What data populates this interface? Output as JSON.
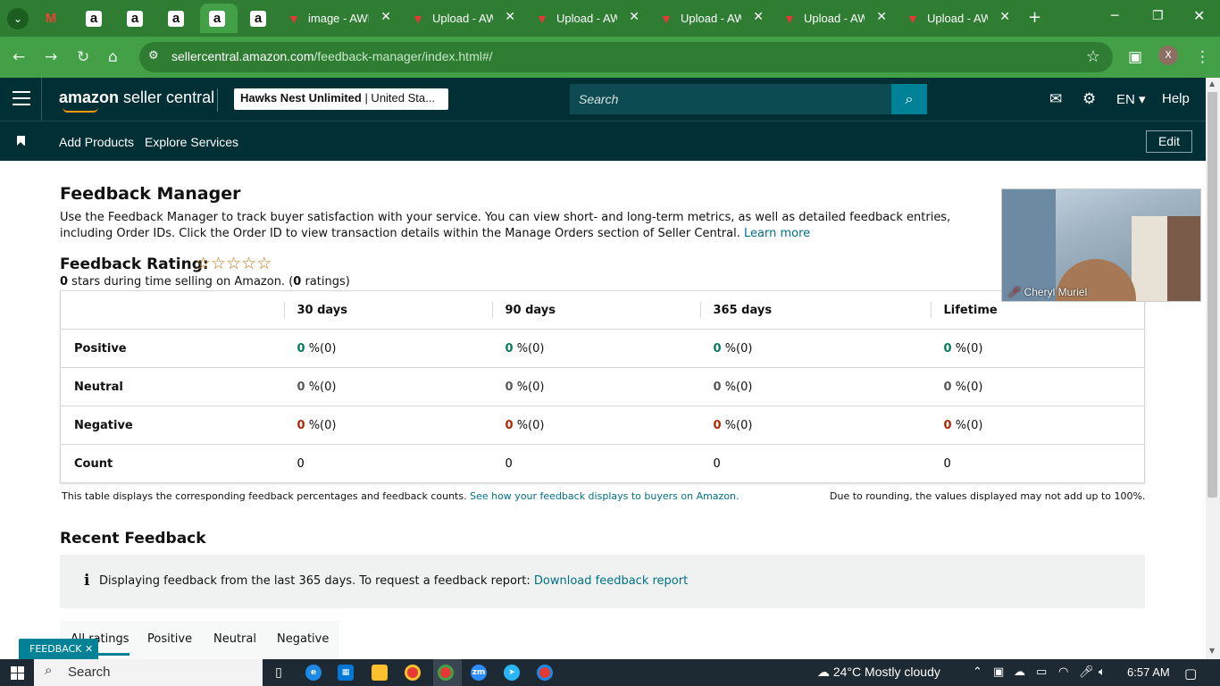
{
  "browser": {
    "tabs": [
      {
        "title": "",
        "icon": "gmail-icon"
      },
      {
        "title": "",
        "icon": "amazon-icon"
      },
      {
        "title": "",
        "icon": "amazon-icon"
      },
      {
        "title": "",
        "icon": "amazon-icon"
      },
      {
        "title": "",
        "icon": "amazon-icon",
        "active": true
      },
      {
        "title": "",
        "icon": "amazon-icon"
      },
      {
        "title": "image - AWL",
        "icon": "aws-icon"
      },
      {
        "title": "Upload - AW",
        "icon": "aws-icon"
      },
      {
        "title": "Upload - AW",
        "icon": "aws-icon"
      },
      {
        "title": "Upload - AW",
        "icon": "aws-icon"
      },
      {
        "title": "Upload - AW",
        "icon": "aws-icon"
      },
      {
        "title": "Upload - AW",
        "icon": "aws-icon"
      }
    ],
    "url_host": "sellercentral.amazon.com",
    "url_path": "/feedback-manager/index.html#/",
    "profile_initial": "X"
  },
  "header": {
    "logo_bold": "amazon",
    "logo_rest": " seller central",
    "store_name": "Hawks Nest Unlimited",
    "store_region": " | United Sta...",
    "search_placeholder": "Search",
    "language": "EN",
    "help": "Help"
  },
  "nav": {
    "links": [
      "Add Products",
      "Explore Services"
    ],
    "edit": "Edit"
  },
  "page": {
    "title": "Feedback Manager",
    "intro_text": "Use the Feedback Manager to track buyer satisfaction with your service. You can view short- and long-term metrics, as well as detailed feedback entries, including Order IDs. Click the Order ID to view transaction details within the Manage Orders section of Seller Central.",
    "learn_more": "Learn more",
    "rating_title": "Feedback Rating:",
    "rating_stars": 0,
    "rating_sub_stars": "0",
    "rating_sub_mid": " stars during time selling on Amazon. (",
    "rating_sub_count": "0",
    "rating_sub_end": " ratings)"
  },
  "table": {
    "columns": [
      "30 days",
      "90 days",
      "365 days",
      "Lifetime"
    ],
    "rows": [
      {
        "label": "Positive",
        "cells": [
          {
            "v": "0",
            "p": "%(0)"
          },
          {
            "v": "0",
            "p": "%(0)"
          },
          {
            "v": "0",
            "p": "%(0)"
          },
          {
            "v": "0",
            "p": "%(0)"
          }
        ]
      },
      {
        "label": "Neutral",
        "cells": [
          {
            "v": "0",
            "p": "%(0)"
          },
          {
            "v": "0",
            "p": "%(0)"
          },
          {
            "v": "0",
            "p": "%(0)"
          },
          {
            "v": "0",
            "p": "%(0)"
          }
        ]
      },
      {
        "label": "Negative",
        "cells": [
          {
            "v": "0",
            "p": "%(0)"
          },
          {
            "v": "0",
            "p": "%(0)"
          },
          {
            "v": "0",
            "p": "%(0)"
          },
          {
            "v": "0",
            "p": "%(0)"
          }
        ]
      },
      {
        "label": "Count",
        "cells": [
          {
            "v": "0"
          },
          {
            "v": "0"
          },
          {
            "v": "0"
          },
          {
            "v": "0"
          }
        ]
      }
    ],
    "note": "This table displays the corresponding feedback percentages and feedback counts.",
    "note_link": "See how your feedback displays to buyers on Amazon.",
    "rounding_note": "Due to rounding, the values displayed may not add up to 100%."
  },
  "recent": {
    "title": "Recent Feedback",
    "info_text": "Displaying feedback from the last 365 days. To request a feedback report:",
    "info_link": "Download feedback report",
    "tabs": [
      "All ratings",
      "Positive",
      "Neutral",
      "Negative"
    ]
  },
  "feedback_tag": "FEEDBACK",
  "video": {
    "participant": "Cheryl Muriel"
  },
  "taskbar": {
    "search": "Search",
    "weather": "24°C  Mostly cloudy",
    "time": "6:57 AM"
  },
  "colors": {
    "chrome_green": "#2e7d32",
    "header_teal": "#002f36",
    "link": "#007185",
    "positive": "#067d62",
    "negative": "#b12704",
    "accent": "#008296"
  }
}
